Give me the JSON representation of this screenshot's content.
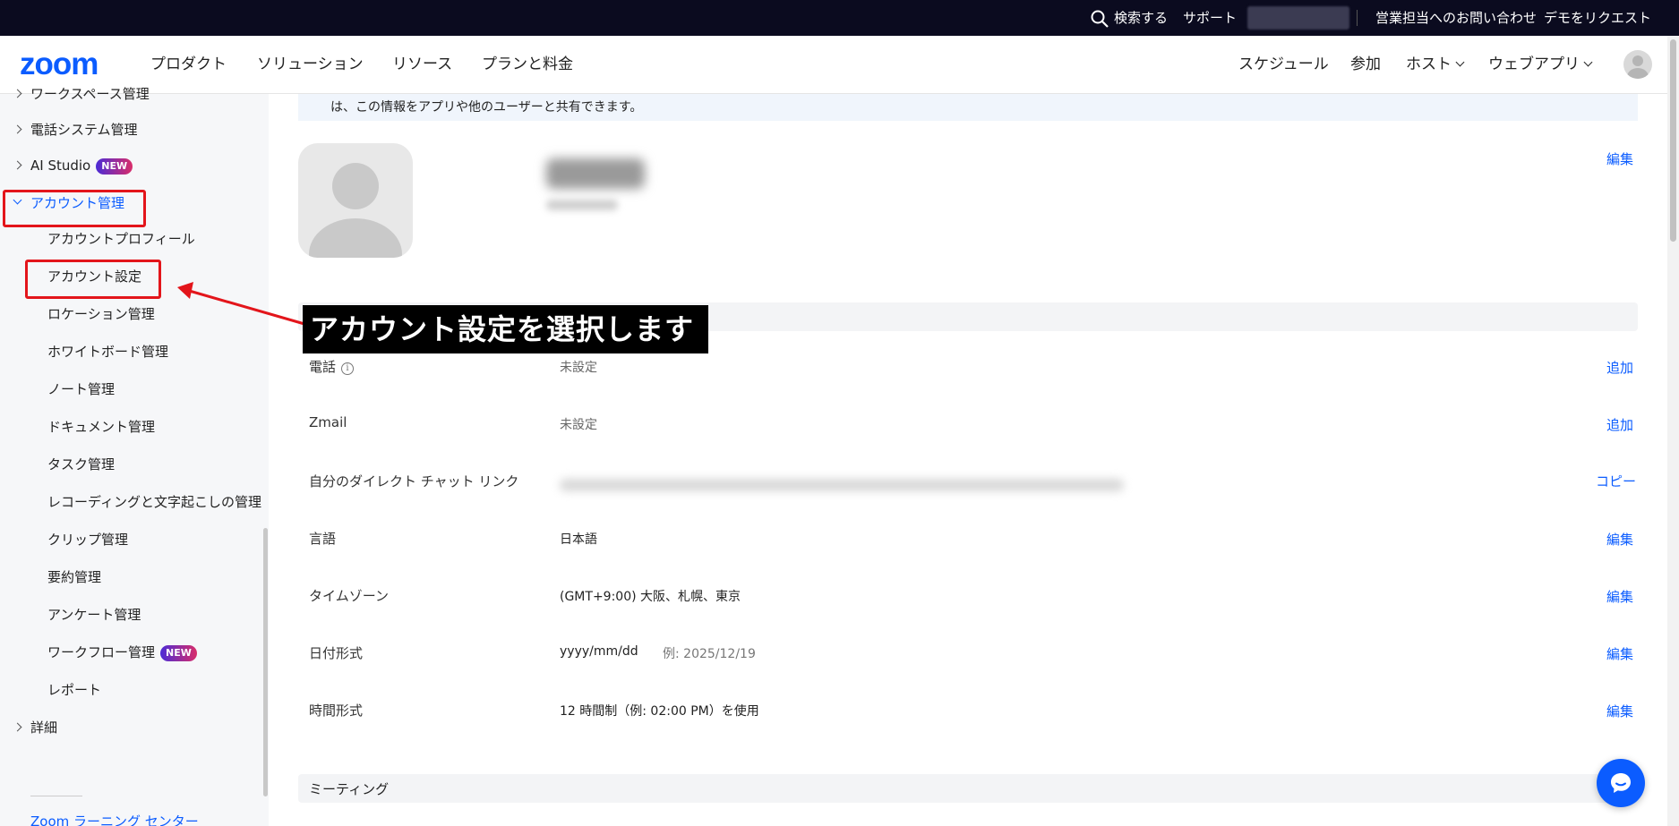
{
  "topbar": {
    "search": "検索する",
    "support": "サポート",
    "contact_sales": "営業担当へのお問い合わせ",
    "request_demo": "デモをリクエスト"
  },
  "nav": {
    "logo": "zoom",
    "products": "プロダクト",
    "solutions": "ソリューション",
    "resources": "リソース",
    "plans": "プランと料金",
    "schedule": "スケジュール",
    "join": "参加",
    "host": "ホスト",
    "web_app": "ウェブアプリ"
  },
  "sidebar": {
    "items": [
      {
        "label": "ワークスペース管理"
      },
      {
        "label": "電話システム管理"
      },
      {
        "label": "AI Studio",
        "badge": "NEW"
      },
      {
        "label": "アカウント管理"
      },
      {
        "label": "アカウントプロフィール"
      },
      {
        "label": "アカウント設定"
      },
      {
        "label": "ロケーション管理"
      },
      {
        "label": "ホワイトボード管理"
      },
      {
        "label": "ノート管理"
      },
      {
        "label": "ドキュメント管理"
      },
      {
        "label": "タスク管理"
      },
      {
        "label": "レコーディングと文字起こしの管理"
      },
      {
        "label": "クリップ管理"
      },
      {
        "label": "要約管理"
      },
      {
        "label": "アンケート管理"
      },
      {
        "label": "ワークフロー管理",
        "badge": "NEW"
      },
      {
        "label": "レポート"
      },
      {
        "label": "詳細"
      },
      {
        "label": "Zoom ラーニング センター"
      }
    ]
  },
  "main": {
    "info_text": "は、この情報をアプリや他のユーザーと共有できます。",
    "edit": "編集",
    "rows": [
      {
        "label": "電話",
        "value": "未設定",
        "action": "追加"
      },
      {
        "label": "Zmail",
        "value": "未設定",
        "action": "追加"
      },
      {
        "label": "自分のダイレクト チャット リンク",
        "value": "",
        "action": "コピー"
      },
      {
        "label": "言語",
        "value": "日本語",
        "action": "編集"
      },
      {
        "label": "タイムゾーン",
        "value": "(GMT+9:00) 大阪、札幌、東京",
        "action": "編集"
      },
      {
        "label": "日付形式",
        "value": "yyyy/mm/dd",
        "example": "例: 2025/12/19",
        "action": "編集"
      },
      {
        "label": "時間形式",
        "value": "12 時間制（例: 02:00 PM）を使用",
        "action": "編集"
      }
    ],
    "meeting_section": "ミーティング"
  },
  "annotation": {
    "callout": "アカウント設定を選択します",
    "color": "#e3151b"
  },
  "colors": {
    "brand": "#0b5cff",
    "topbar": "#0b0b1f"
  }
}
